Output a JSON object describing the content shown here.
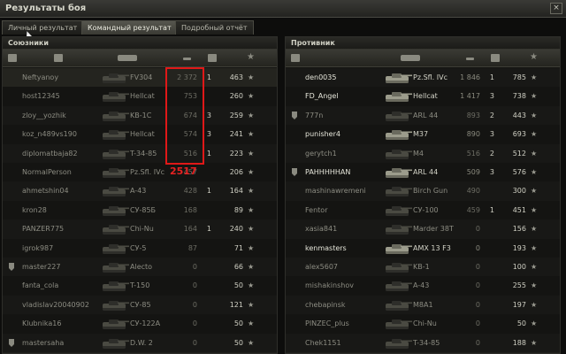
{
  "window": {
    "title": "Результаты боя",
    "close_glyph": "×"
  },
  "tabs": [
    {
      "label": "Личный результат",
      "active": false
    },
    {
      "label": "Командный результат",
      "active": true
    },
    {
      "label": "Подробный отчёт",
      "active": false
    }
  ],
  "teams": {
    "allies": {
      "title": "Союзники",
      "rows": [
        {
          "player": "Neftyanoy",
          "vehicle": "FV304",
          "damage": "2 372",
          "kills": "1",
          "xp": "463",
          "alive": false,
          "medal": false,
          "highlight": true
        },
        {
          "player": "host12345",
          "vehicle": "Hellcat",
          "damage": "753",
          "kills": "",
          "xp": "260",
          "alive": false,
          "medal": false
        },
        {
          "player": "zloy__yozhik",
          "vehicle": "KB-1C",
          "damage": "674",
          "kills": "3",
          "xp": "259",
          "alive": false,
          "medal": false
        },
        {
          "player": "koz_n489vs190",
          "vehicle": "Hellcat",
          "damage": "574",
          "kills": "3",
          "xp": "241",
          "alive": false,
          "medal": false
        },
        {
          "player": "diplomatbaja82",
          "vehicle": "T-34-85",
          "damage": "516",
          "kills": "1",
          "xp": "223",
          "alive": false,
          "medal": false
        },
        {
          "player": "NormalPerson",
          "vehicle": "Pz.Sfl. IVc",
          "damage": "457",
          "kills": "",
          "xp": "206",
          "alive": false,
          "medal": false
        },
        {
          "player": "ahmetshin04",
          "vehicle": "A-43",
          "damage": "428",
          "kills": "1",
          "xp": "164",
          "alive": false,
          "medal": false
        },
        {
          "player": "kron28",
          "vehicle": "СУ-85Б",
          "damage": "168",
          "kills": "",
          "xp": "89",
          "alive": false,
          "medal": false
        },
        {
          "player": "PANZER775",
          "vehicle": "Chi-Nu",
          "damage": "164",
          "kills": "1",
          "xp": "240",
          "alive": false,
          "medal": false
        },
        {
          "player": "igrok987",
          "vehicle": "СУ-5",
          "damage": "87",
          "kills": "",
          "xp": "71",
          "alive": false,
          "medal": false
        },
        {
          "player": "master227",
          "vehicle": "Alecto",
          "damage": "0",
          "kills": "",
          "xp": "66",
          "alive": false,
          "medal": true
        },
        {
          "player": "fanta_cola",
          "vehicle": "T-150",
          "damage": "0",
          "kills": "",
          "xp": "50",
          "alive": false,
          "medal": false
        },
        {
          "player": "vladislav20040902",
          "vehicle": "СУ-85",
          "damage": "0",
          "kills": "",
          "xp": "121",
          "alive": false,
          "medal": false
        },
        {
          "player": "Klubnika16",
          "vehicle": "СУ-122А",
          "damage": "0",
          "kills": "",
          "xp": "50",
          "alive": false,
          "medal": false
        },
        {
          "player": "mastersaha",
          "vehicle": "D.W. 2",
          "damage": "0",
          "kills": "",
          "xp": "50",
          "alive": false,
          "medal": true
        }
      ]
    },
    "enemies": {
      "title": "Противник",
      "rows": [
        {
          "player": "den0035",
          "vehicle": "Pz.Sfl. IVc",
          "damage": "1 846",
          "kills": "1",
          "xp": "785",
          "alive": true,
          "medal": false
        },
        {
          "player": "FD_Angel",
          "vehicle": "Hellcat",
          "damage": "1 417",
          "kills": "3",
          "xp": "738",
          "alive": true,
          "medal": false
        },
        {
          "player": "777n",
          "vehicle": "ARL 44",
          "damage": "893",
          "kills": "2",
          "xp": "443",
          "alive": false,
          "medal": true
        },
        {
          "player": "punisher4",
          "vehicle": "M37",
          "damage": "890",
          "kills": "3",
          "xp": "693",
          "alive": true,
          "medal": false
        },
        {
          "player": "gerytch1",
          "vehicle": "M4",
          "damage": "516",
          "kills": "2",
          "xp": "512",
          "alive": false,
          "medal": false
        },
        {
          "player": "PAHHHHHAN",
          "vehicle": "ARL 44",
          "damage": "509",
          "kills": "3",
          "xp": "576",
          "alive": true,
          "medal": true
        },
        {
          "player": "mashinawremeni",
          "vehicle": "Birch Gun",
          "damage": "490",
          "kills": "",
          "xp": "300",
          "alive": false,
          "medal": false
        },
        {
          "player": "Fentor",
          "vehicle": "СУ-100",
          "damage": "459",
          "kills": "1",
          "xp": "451",
          "alive": false,
          "medal": false
        },
        {
          "player": "xasia841",
          "vehicle": "Marder 38T",
          "damage": "0",
          "kills": "",
          "xp": "156",
          "alive": false,
          "medal": false
        },
        {
          "player": "kenmasters",
          "vehicle": "AMX 13 F3",
          "damage": "0",
          "kills": "",
          "xp": "193",
          "alive": true,
          "medal": false
        },
        {
          "player": "alex5607",
          "vehicle": "KB-1",
          "damage": "0",
          "kills": "",
          "xp": "100",
          "alive": false,
          "medal": false
        },
        {
          "player": "mishakinshov",
          "vehicle": "A-43",
          "damage": "0",
          "kills": "",
          "xp": "255",
          "alive": false,
          "medal": false
        },
        {
          "player": "chebapinsk",
          "vehicle": "M8A1",
          "damage": "0",
          "kills": "",
          "xp": "197",
          "alive": false,
          "medal": false
        },
        {
          "player": "PINZEC_plus",
          "vehicle": "Chi-Nu",
          "damage": "0",
          "kills": "",
          "xp": "50",
          "alive": false,
          "medal": false
        },
        {
          "player": "Chek1151",
          "vehicle": "T-34-85",
          "damage": "0",
          "kills": "",
          "xp": "188",
          "alive": false,
          "medal": false
        }
      ]
    }
  },
  "annotation": {
    "text": "2517",
    "color": "#e01818"
  },
  "colors": {
    "alive_text": "#e6e6da",
    "dead_text": "#8c8c82",
    "marker": "#e01818"
  }
}
